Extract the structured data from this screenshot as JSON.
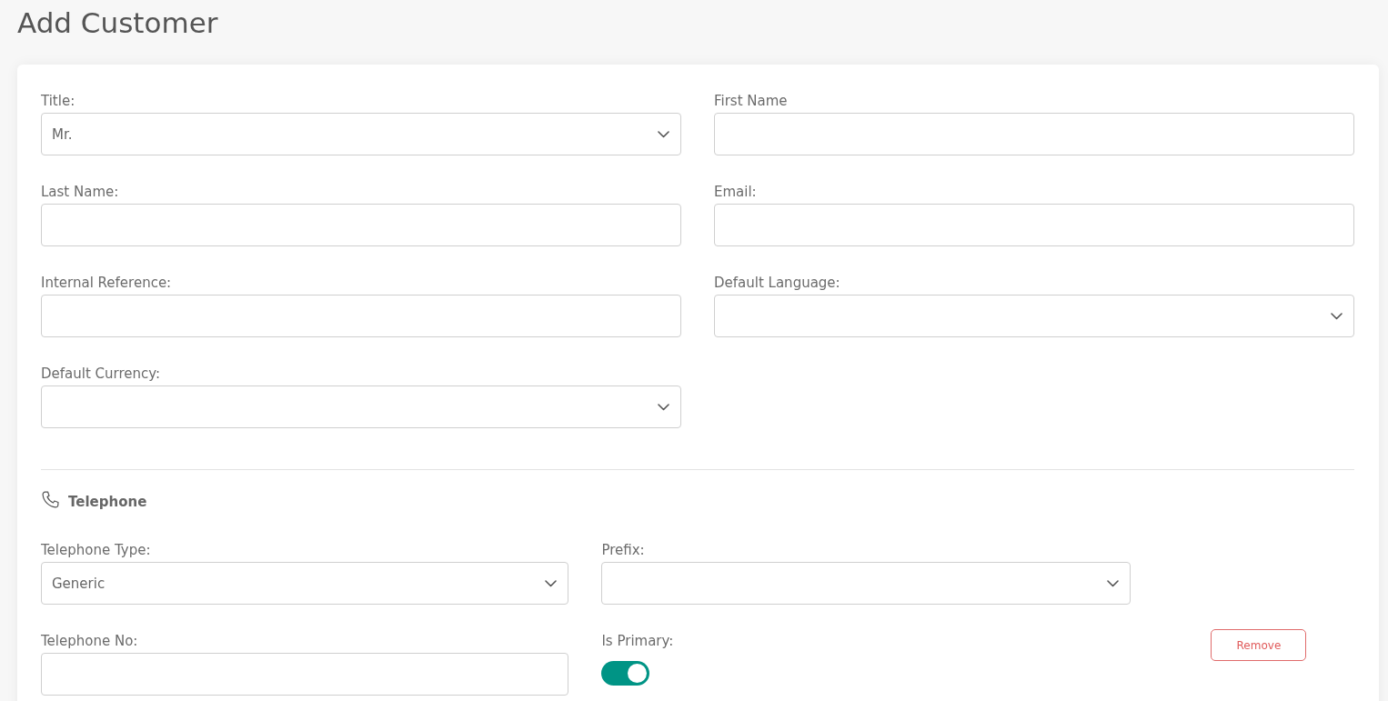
{
  "page": {
    "title": "Add Customer"
  },
  "customer_fields": [
    {
      "label": "Title:",
      "kind": "select",
      "value": "Mr."
    },
    {
      "label": "First Name",
      "kind": "text"
    },
    {
      "label": "Last Name:",
      "kind": "text"
    },
    {
      "label": "Email:",
      "kind": "text"
    },
    {
      "label": "Internal Reference:",
      "kind": "text"
    },
    {
      "label": "Default Language:",
      "kind": "select"
    },
    {
      "label": "Default Currency:",
      "kind": "select"
    }
  ],
  "telephone": {
    "heading": "Telephone",
    "fields": [
      {
        "label": "Telephone Type:",
        "kind": "select",
        "value": "Generic"
      },
      {
        "label": "Prefix:",
        "kind": "select"
      },
      {
        "label": "Telephone No:",
        "kind": "text"
      },
      {
        "label": "Is Primary:",
        "kind": "toggle",
        "on": true
      }
    ],
    "remove_button": "Remove"
  }
}
